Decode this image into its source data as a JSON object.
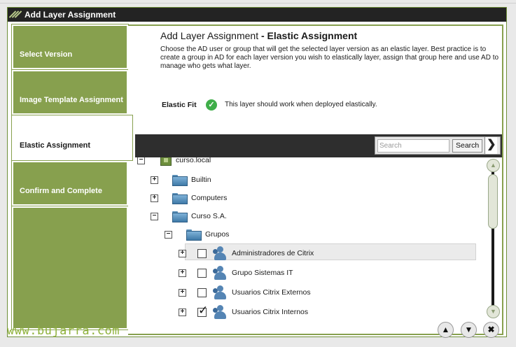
{
  "window": {
    "title": "Add Layer Assignment"
  },
  "steps": [
    {
      "label": "Select Version"
    },
    {
      "label": "Image Template Assignment"
    },
    {
      "label": "Elastic Assignment"
    },
    {
      "label": "Confirm and Complete"
    }
  ],
  "main": {
    "title_prefix": "Add Layer Assignment",
    "title_separator": " - ",
    "title_section": "Elastic Assignment",
    "description": "Choose the AD user or group that will get the selected layer version as an elastic layer.  Best practice is to create a group in AD for each layer version you wish to elastically layer, assign that group here and use AD to manage who gets what layer.",
    "elastic_fit_label": "Elastic Fit",
    "elastic_fit_text": "This layer should work when deployed elastically."
  },
  "search": {
    "placeholder": "Search",
    "button_label": "Search"
  },
  "tree": {
    "root": "curso.local",
    "folders": [
      "Builtin",
      "Computers",
      "Curso S.A."
    ],
    "subfolder": "Grupos",
    "groups": [
      {
        "name": "Administradores de Citrix",
        "checked": false
      },
      {
        "name": "Grupo Sistemas IT",
        "checked": false
      },
      {
        "name": "Usuarios Citrix Externos",
        "checked": false
      },
      {
        "name": "Usuarios Citrix Internos",
        "checked": true
      }
    ],
    "expander_collapsed": "+",
    "expander_expanded": "−"
  },
  "nav": {
    "up": "▲",
    "down": "▼",
    "close": "✖",
    "next": "❯"
  },
  "watermark": "www.bujarra.com",
  "colors": {
    "accent": "#87a04e",
    "titlebar": "#232323",
    "success": "#3fae49"
  }
}
